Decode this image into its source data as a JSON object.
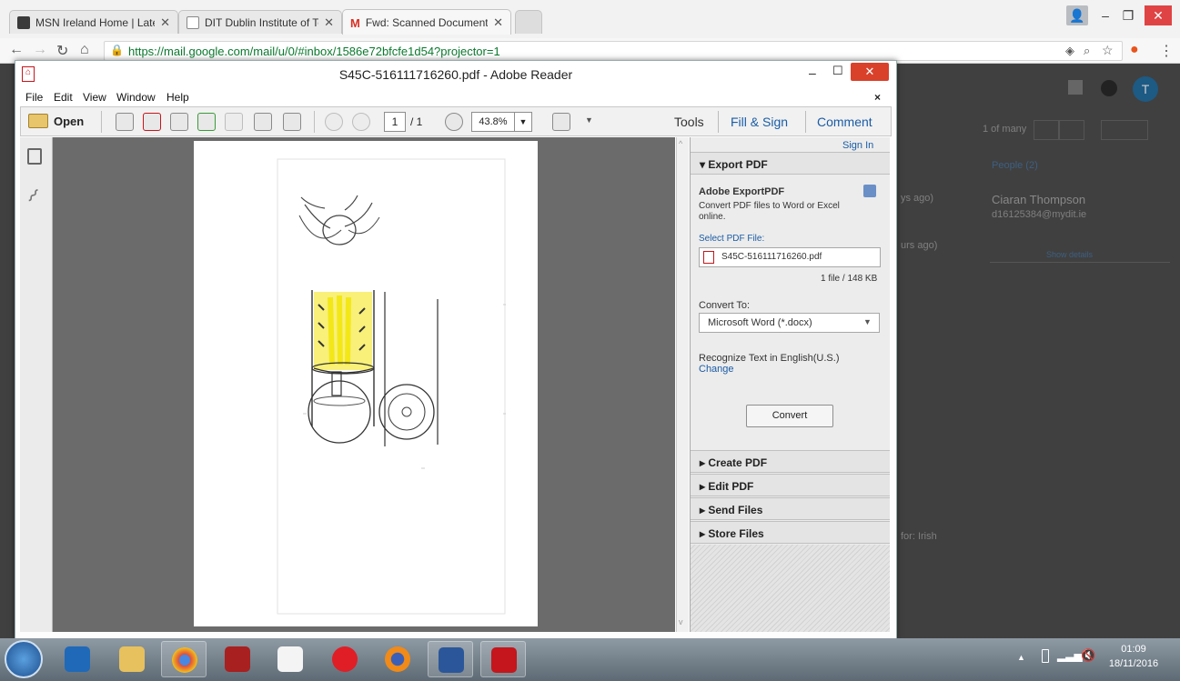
{
  "browser": {
    "tabs": [
      {
        "title": "MSN Ireland Home | Late",
        "favicon_color": "#3a3a3a"
      },
      {
        "title": "DIT Dublin Institute of Te",
        "favicon_color": "#ffffff"
      },
      {
        "title": "Fwd: Scanned Document",
        "favicon_color": "#d93025"
      }
    ],
    "url": "https://mail.google.com/mail/u/0/#inbox/1586e72bfcfe1d54?projector=1"
  },
  "gmail": {
    "pager": "1 of many",
    "people_header": "People (2)",
    "contact_name": "Ciaran Thompson",
    "contact_email": "d16125384@mydit.ie",
    "show_details": "Show details",
    "ago1": "ys ago)",
    "ago2": "urs ago)",
    "label_chip": "for: Irish"
  },
  "reader": {
    "title": "S45C-516111716260.pdf - Adobe Reader",
    "menu": [
      "File",
      "Edit",
      "View",
      "Window",
      "Help"
    ],
    "toolbar": {
      "open_label": "Open",
      "page_current": "1",
      "page_total": "/ 1",
      "zoom": "43.8%",
      "tools": "Tools",
      "fill_sign": "Fill & Sign",
      "comment": "Comment"
    },
    "pane": {
      "sign_in": "Sign In",
      "export_header": "Export PDF",
      "export_title": "Adobe ExportPDF",
      "export_desc": "Convert PDF files to Word or Excel online.",
      "select_label": "Select PDF File:",
      "file_name": "S45C-516111716260.pdf",
      "file_info": "1 file / 148 KB",
      "convert_to_label": "Convert To:",
      "convert_to_value": "Microsoft Word (*.docx)",
      "recognize": "Recognize Text in English(U.S.)",
      "change": "Change",
      "convert_button": "Convert",
      "sections": [
        "Create PDF",
        "Edit PDF",
        "Send Files",
        "Store Files"
      ]
    }
  },
  "taskbar": {
    "time": "01:09",
    "date": "18/11/2016"
  },
  "colors": {
    "link_blue": "#1a5ca6",
    "pdf_red": "#c4161c",
    "accent_yellow": "#f3e600"
  }
}
